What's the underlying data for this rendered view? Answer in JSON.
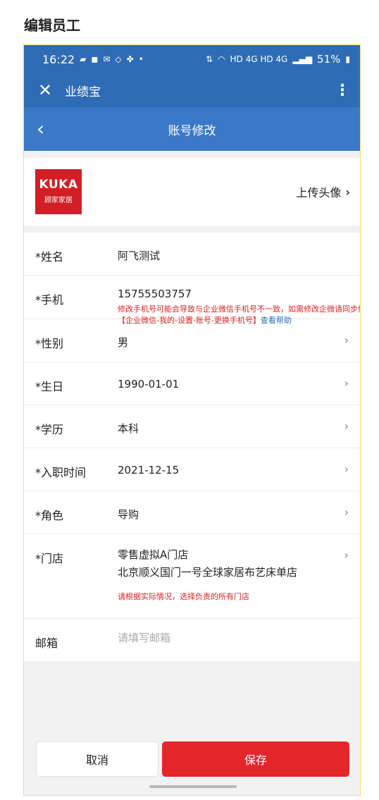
{
  "page": {
    "heading": "编辑员工"
  },
  "status_bar": {
    "time": "16:22",
    "left_icons": [
      "message-icon",
      "app-icon",
      "sms-icon",
      "location-icon",
      "paw-icon",
      "dot-icon"
    ],
    "network_text": "HD 4G HD 4G",
    "battery": "51%"
  },
  "app_bar": {
    "title": "业绩宝"
  },
  "nav": {
    "title": "账号修改"
  },
  "avatar": {
    "brand_name": "KUKA",
    "brand_sub": "顾家家居",
    "upload_label": "上传头像"
  },
  "form": {
    "name": {
      "label": "*姓名",
      "value": "阿飞测试"
    },
    "phone": {
      "label": "*手机",
      "value": "15755503757",
      "warning": "修改手机号可能会导致与企业微信手机号不一致，如需修改企微请同步修改",
      "warning_path": "【企业微信-我的-设置-账号-更换手机号】",
      "help_link": "查看帮助"
    },
    "gender": {
      "label": "*性别",
      "value": "男"
    },
    "birthday": {
      "label": "*生日",
      "value": "1990-01-01"
    },
    "education": {
      "label": "*学历",
      "value": "本科"
    },
    "hire_date": {
      "label": "*入职时间",
      "value": "2021-12-15"
    },
    "role": {
      "label": "*角色",
      "value": "导购"
    },
    "store": {
      "label": "*门店",
      "line1": "零售虚拟A门店",
      "line2": "北京顺义国门一号全球家居布艺床单店",
      "note": "请根据实际情况，选择负责的所有门店"
    },
    "email": {
      "label": "邮箱",
      "placeholder": "请填写邮箱",
      "value": ""
    }
  },
  "buttons": {
    "cancel": "取消",
    "save": "保存"
  },
  "colors": {
    "header_blue": "#2f6cb6",
    "nav_blue": "#3b79c8",
    "accent_red": "#e3262a",
    "brand_red": "#d31e25"
  }
}
